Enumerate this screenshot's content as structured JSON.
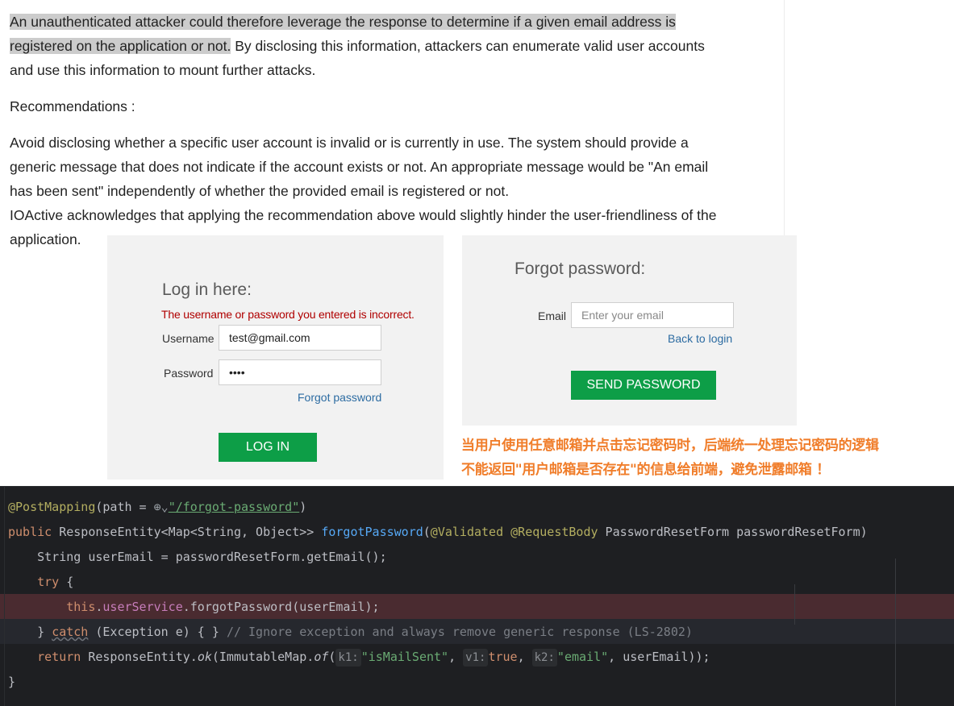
{
  "report": {
    "para1_highlight_a": "An unauthenticated attacker could therefore leverage the response to determine if a given email address is",
    "para1_highlight_b": "registered on the application or not.",
    "para1_rest_b": " By disclosing this information, attackers can enumerate valid user accounts",
    "para1_line3": "and use this information to mount further attacks.",
    "recommendations_heading": "Recommendations :",
    "para2_line1": "Avoid disclosing whether a specific user account is invalid or is currently in use. The system should provide a",
    "para2_line2": "generic message that does not indicate if the account exists or not. An appropriate message would be \"An email",
    "para2_line3": "has been sent\" independently of whether the provided email is registered or not.",
    "para3_line1": "IOActive acknowledges that applying the recommendation above would slightly hinder the user-friendliness of the",
    "para3_line2": "application."
  },
  "login": {
    "title": "Log in here:",
    "error": "The username or password you entered is incorrect.",
    "username_label": "Username",
    "username_value": "test@gmail.com",
    "password_label": "Password",
    "password_value": "••••",
    "forgot_link": "Forgot password",
    "login_button": "LOG IN"
  },
  "forgot": {
    "title": "Forgot password:",
    "email_label": "Email",
    "email_placeholder": "Enter your email",
    "back_link": "Back to login",
    "send_button": "SEND PASSWORD"
  },
  "note": {
    "line1": "当用户使用任意邮箱并点击忘记密码时，后端统一处理忘记密码的逻辑",
    "line2": "不能返回\"用户邮箱是否存在\"的信息给前端，避免泄露邮箱 ！"
  },
  "code": {
    "l1": {
      "annotation": "@PostMapping",
      "open": "(path = ",
      "globe": "⊕",
      "chev": "⌄",
      "path": "\"/forgot-password\"",
      "close": ")"
    },
    "l2": {
      "kw": "public",
      "type": " ResponseEntity<Map<String, Object>> ",
      "fn": "forgotPassword",
      "open": "(",
      "ann1": "@Validated",
      "sp": " ",
      "ann2": "@RequestBody",
      "rest": " PasswordResetForm passwordResetForm)"
    },
    "l3": {
      "text": "    String userEmail = passwordResetForm.getEmail();"
    },
    "l4": {
      "kw": "try",
      "rest": " {"
    },
    "l5": {
      "kw": "this",
      "dot": ".",
      "field": "userService",
      "rest": ".forgotPassword(userEmail);"
    },
    "l6": {
      "open": "} ",
      "kw": "catch",
      "mid": " (Exception e) { } ",
      "comment": "// Ignore exception and always remove generic response (LS-2802)"
    },
    "l7": {
      "kw": "return",
      "a": " ResponseEntity.",
      "ok": "ok",
      "b": "(ImmutableMap.",
      "of": "of",
      "c": "(",
      "k1": "k1:",
      "s1": "\"isMailSent\"",
      "comma1": ", ",
      "v1": "v1:",
      "t": "true",
      "comma2": ", ",
      "k2": "k2:",
      "s2": "\"email\"",
      "end": ", userEmail));"
    },
    "l8": {
      "text": "}"
    }
  },
  "colors": {
    "accent_green": "#0d9e47",
    "error_red": "#b00000",
    "link_blue": "#2d6ca2",
    "note_orange": "#f07d2a",
    "editor_bg": "#1e1f22",
    "error_line_bg": "#4a2b30"
  }
}
